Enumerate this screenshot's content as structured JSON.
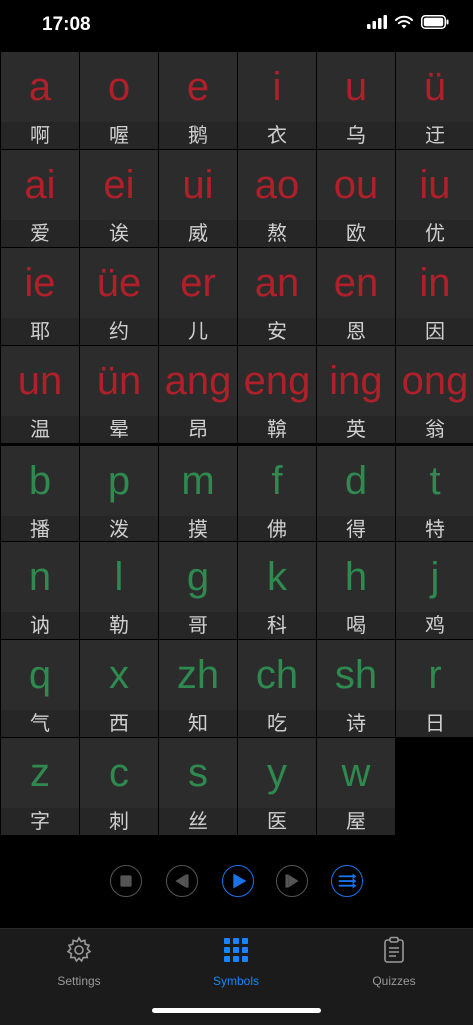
{
  "status": {
    "time": "17:08"
  },
  "cells": [
    {
      "sym": "a",
      "cn": "啊",
      "type": "red"
    },
    {
      "sym": "o",
      "cn": "喔",
      "type": "red"
    },
    {
      "sym": "e",
      "cn": "鹅",
      "type": "red"
    },
    {
      "sym": "i",
      "cn": "衣",
      "type": "red"
    },
    {
      "sym": "u",
      "cn": "乌",
      "type": "red"
    },
    {
      "sym": "ü",
      "cn": "迂",
      "type": "red"
    },
    {
      "sym": "ai",
      "cn": "爱",
      "type": "red"
    },
    {
      "sym": "ei",
      "cn": "诶",
      "type": "red"
    },
    {
      "sym": "ui",
      "cn": "威",
      "type": "red"
    },
    {
      "sym": "ao",
      "cn": "熬",
      "type": "red"
    },
    {
      "sym": "ou",
      "cn": "欧",
      "type": "red"
    },
    {
      "sym": "iu",
      "cn": "优",
      "type": "red"
    },
    {
      "sym": "ie",
      "cn": "耶",
      "type": "red"
    },
    {
      "sym": "üe",
      "cn": "约",
      "type": "red"
    },
    {
      "sym": "er",
      "cn": "儿",
      "type": "red"
    },
    {
      "sym": "an",
      "cn": "安",
      "type": "red"
    },
    {
      "sym": "en",
      "cn": "恩",
      "type": "red"
    },
    {
      "sym": "in",
      "cn": "因",
      "type": "red"
    },
    {
      "sym": "un",
      "cn": "温",
      "type": "red"
    },
    {
      "sym": "ün",
      "cn": "晕",
      "type": "red"
    },
    {
      "sym": "ang",
      "cn": "昂",
      "type": "red"
    },
    {
      "sym": "eng",
      "cn": "鞥",
      "type": "red"
    },
    {
      "sym": "ing",
      "cn": "英",
      "type": "red"
    },
    {
      "sym": "ong",
      "cn": "翁",
      "type": "red"
    },
    {
      "sym": "b",
      "cn": "播",
      "type": "green"
    },
    {
      "sym": "p",
      "cn": "泼",
      "type": "green"
    },
    {
      "sym": "m",
      "cn": "摸",
      "type": "green"
    },
    {
      "sym": "f",
      "cn": "佛",
      "type": "green"
    },
    {
      "sym": "d",
      "cn": "得",
      "type": "green"
    },
    {
      "sym": "t",
      "cn": "特",
      "type": "green"
    },
    {
      "sym": "n",
      "cn": "讷",
      "type": "green"
    },
    {
      "sym": "l",
      "cn": "勒",
      "type": "green"
    },
    {
      "sym": "g",
      "cn": "哥",
      "type": "green"
    },
    {
      "sym": "k",
      "cn": "科",
      "type": "green"
    },
    {
      "sym": "h",
      "cn": "喝",
      "type": "green"
    },
    {
      "sym": "j",
      "cn": "鸡",
      "type": "green"
    },
    {
      "sym": "q",
      "cn": "气",
      "type": "green"
    },
    {
      "sym": "x",
      "cn": "西",
      "type": "green"
    },
    {
      "sym": "zh",
      "cn": "知",
      "type": "green"
    },
    {
      "sym": "ch",
      "cn": "吃",
      "type": "green"
    },
    {
      "sym": "sh",
      "cn": "诗",
      "type": "green"
    },
    {
      "sym": "r",
      "cn": "日",
      "type": "green"
    },
    {
      "sym": "z",
      "cn": "字",
      "type": "green"
    },
    {
      "sym": "c",
      "cn": "刺",
      "type": "green"
    },
    {
      "sym": "s",
      "cn": "丝",
      "type": "green"
    },
    {
      "sym": "y",
      "cn": "医",
      "type": "green"
    },
    {
      "sym": "w",
      "cn": "屋",
      "type": "green"
    }
  ],
  "controls": [
    {
      "name": "stop-button",
      "icon": "stop-icon",
      "active": false
    },
    {
      "name": "previous-button",
      "icon": "previous-icon",
      "active": false
    },
    {
      "name": "play-button",
      "icon": "play-icon",
      "active": true
    },
    {
      "name": "next-button",
      "icon": "next-icon",
      "active": false
    },
    {
      "name": "playlist-button",
      "icon": "list-icon",
      "active": true
    }
  ],
  "tabs": [
    {
      "label": "Settings",
      "icon": "gear-icon",
      "active": false
    },
    {
      "label": "Symbols",
      "icon": "grid-icon",
      "active": true
    },
    {
      "label": "Quizzes",
      "icon": "clipboard-icon",
      "active": false
    }
  ],
  "colors": {
    "vowel": "#b0202a",
    "consonant": "#2e8a4f",
    "accent": "#1a84ff"
  }
}
